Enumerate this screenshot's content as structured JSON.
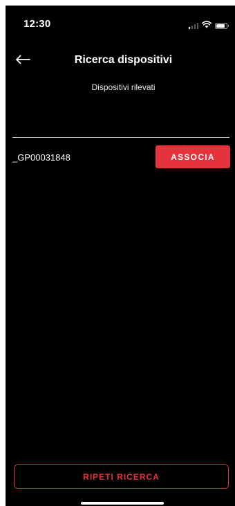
{
  "status_bar": {
    "time": "12:30",
    "icons": [
      "signal-icon",
      "wifi-icon",
      "battery-icon"
    ]
  },
  "header": {
    "back_icon": "arrow-left-icon",
    "title": "Ricerca dispositivi"
  },
  "subtitle": "Dispositivi rilevati",
  "devices": [
    {
      "name": "_GP00031848",
      "action_label": "ASSOCIA"
    }
  ],
  "footer": {
    "retry_label": "RIPETI RICERCA"
  },
  "colors": {
    "background": "#000000",
    "accent": "#e5323c",
    "text": "#ffffff"
  }
}
